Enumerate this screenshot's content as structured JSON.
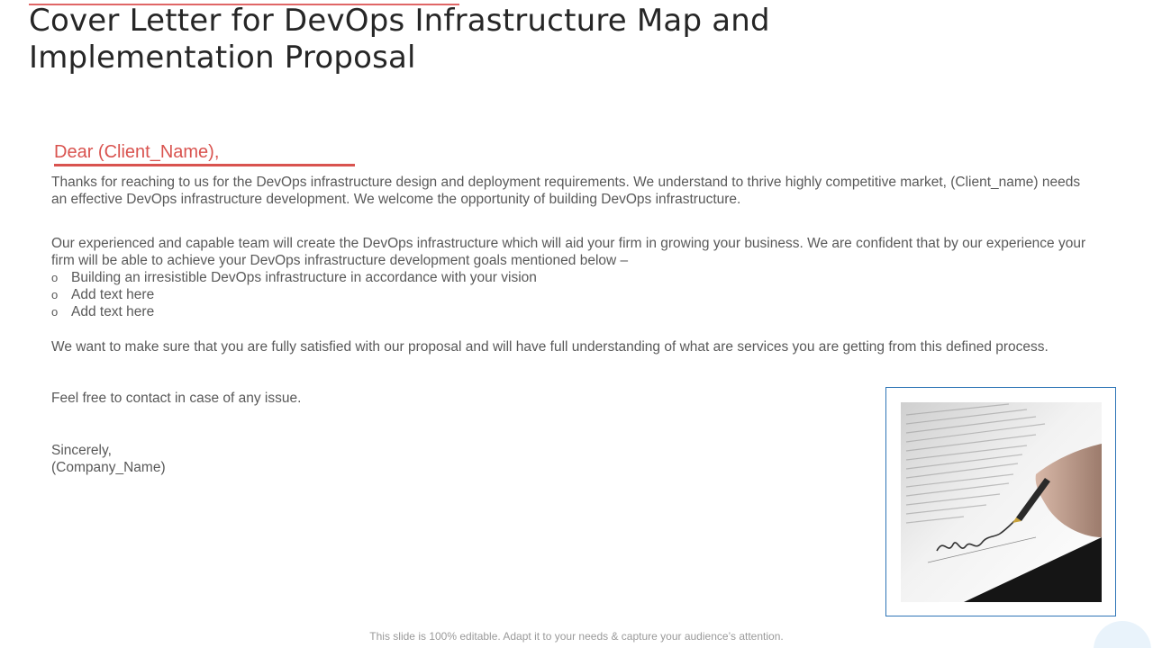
{
  "slide": {
    "title": "Cover Letter for DevOps Infrastructure Map and Implementation Proposal",
    "salutation": "Dear (Client_Name),",
    "paragraph1": "Thanks for reaching to us for the DevOps infrastructure design and deployment requirements. We understand to thrive highly competitive market, (Client_name) needs an effective DevOps infrastructure development. We welcome the opportunity of building DevOps infrastructure.",
    "paragraph2": "Our experienced and capable team will create the DevOps infrastructure which will aid your firm in growing your business. We are confident that by our experience your firm will be able to achieve your DevOps infrastructure development goals mentioned below –",
    "bullet_marker": "o",
    "bullets": [
      "Building an irresistible DevOps infrastructure in accordance with your vision",
      "Add text here",
      "Add text here"
    ],
    "paragraph3": "We want to make sure that you are fully satisfied with our proposal and will have full understanding of what are services you are getting from this defined process.",
    "paragraph4": "Feel free to contact in case of any issue.",
    "closing": "Sincerely,",
    "company": "(Company_Name)",
    "footer": "This slide is 100% editable. Adapt it to your needs & capture your audience’s attention."
  },
  "colors": {
    "accent": "#d9534f",
    "title_text": "#262626",
    "body_text": "#595959",
    "frame_border": "#2e75b6"
  },
  "image": {
    "icon": "signing-document-photo"
  }
}
